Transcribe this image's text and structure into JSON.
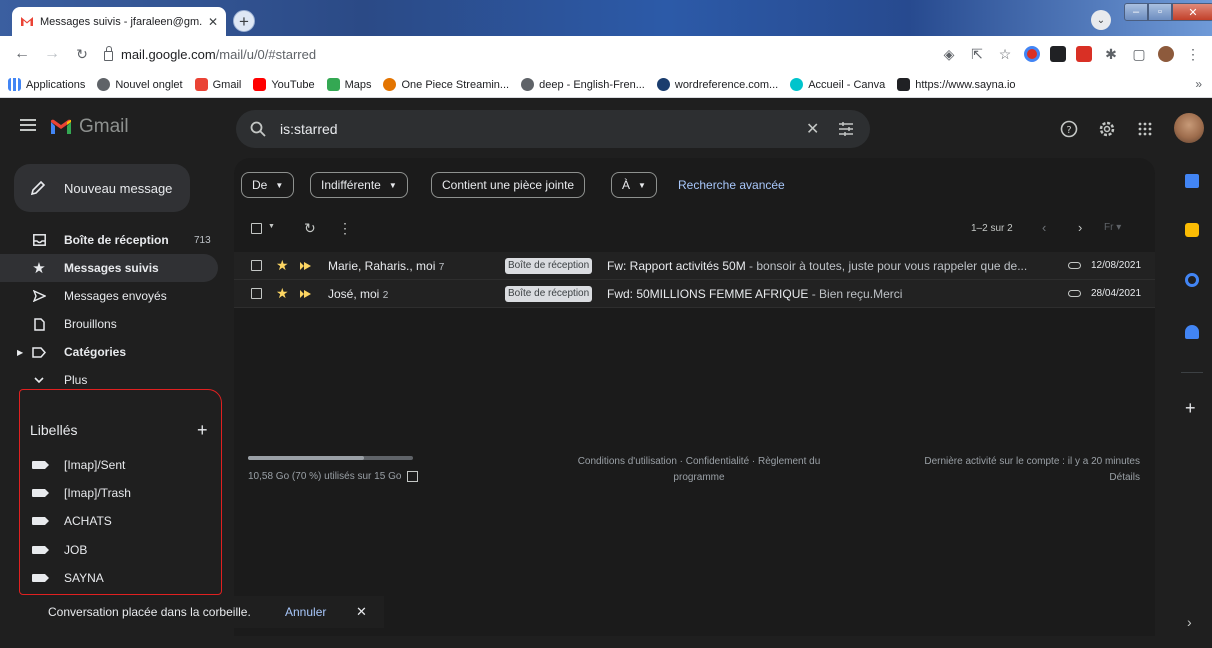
{
  "browser": {
    "tab_title": "Messages suivis - jfaraleen@gm...",
    "tab_close": "✕",
    "new_tab": "+",
    "url_host": "mail.google.com",
    "url_path": "/mail/u/0/#starred",
    "bookmarks": [
      {
        "label": "Applications",
        "icon": "apps-grid-icon",
        "color": "#4285f4"
      },
      {
        "label": "Nouvel onglet",
        "icon": "globe-icon",
        "color": "#5f6368"
      },
      {
        "label": "Gmail",
        "icon": "gmail-icon",
        "color": "#ea4335"
      },
      {
        "label": "YouTube",
        "icon": "youtube-icon",
        "color": "#ff0000"
      },
      {
        "label": "Maps",
        "icon": "maps-icon",
        "color": "#34a853"
      },
      {
        "label": "One Piece Streamin...",
        "icon": "one-piece-icon",
        "color": "#e37400"
      },
      {
        "label": "deep - English-Fren...",
        "icon": "globe-icon",
        "color": "#5f6368"
      },
      {
        "label": "wordreference.com...",
        "icon": "wordreference-icon",
        "color": "#1a3d6e"
      },
      {
        "label": "Accueil - Canva",
        "icon": "canva-icon",
        "color": "#00c4cc"
      },
      {
        "label": "https://www.sayna.io",
        "icon": "sayna-icon",
        "color": "#202124"
      }
    ],
    "bookmarks_more": "»"
  },
  "gmail": {
    "logo_text": "Gmail",
    "search_query": "is:starred",
    "compose_label": "Nouveau message",
    "nav": [
      {
        "label": "Boîte de réception",
        "count": "713",
        "icon": "inbox-icon",
        "bold": true,
        "active": false
      },
      {
        "label": "Messages suivis",
        "count": "",
        "icon": "star-icon",
        "bold": true,
        "active": true
      },
      {
        "label": "Messages envoyés",
        "count": "",
        "icon": "send-icon",
        "bold": false,
        "active": false
      },
      {
        "label": "Brouillons",
        "count": "",
        "icon": "draft-icon",
        "bold": false,
        "active": false
      },
      {
        "label": "Catégories",
        "count": "",
        "icon": "label-icon",
        "bold": true,
        "active": false
      },
      {
        "label": "Plus",
        "count": "",
        "icon": "chevron-down-icon",
        "bold": false,
        "active": false
      }
    ],
    "labels_title": "Libellés",
    "labels_add": "+",
    "labels": [
      "[Imap]/Sent",
      "[Imap]/Trash",
      "ACHATS",
      "JOB",
      "SAYNA"
    ],
    "filters": {
      "from": "De",
      "any_time": "Indifférente",
      "has_attachment": "Contient une pièce jointe",
      "to": "À",
      "advanced": "Recherche avancée"
    },
    "pager": "1–2 sur 2",
    "emails": [
      {
        "sender": "Marie, Raharis., moi",
        "count": "7",
        "label": "Boîte de réception",
        "subject": "Fw: Rapport activités 50M",
        "snippet": " - bonsoir à toutes, juste pour vous rappeler que de...",
        "date": "12/08/2021"
      },
      {
        "sender": "José, moi",
        "count": "2",
        "label": "Boîte de réception",
        "subject": "Fwd: 50MILLIONS FEMME AFRIQUE",
        "snippet": " - Bien reçu.Merci",
        "date": "28/04/2021"
      }
    ],
    "storage_text": "10,58 Go (70 %) utilisés sur 15 Go",
    "storage_fraction": 0.7,
    "footer_links_1": "Conditions d'utilisation · Confidentialité · Règlement du",
    "footer_links_2": "programme",
    "activity_1": "Dernière activité sur le compte : il y a 20 minutes",
    "activity_2": "Détails",
    "snackbar_text": "Conversation placée dans la corbeille.",
    "snackbar_undo": "Annuler",
    "snackbar_close": "✕"
  }
}
